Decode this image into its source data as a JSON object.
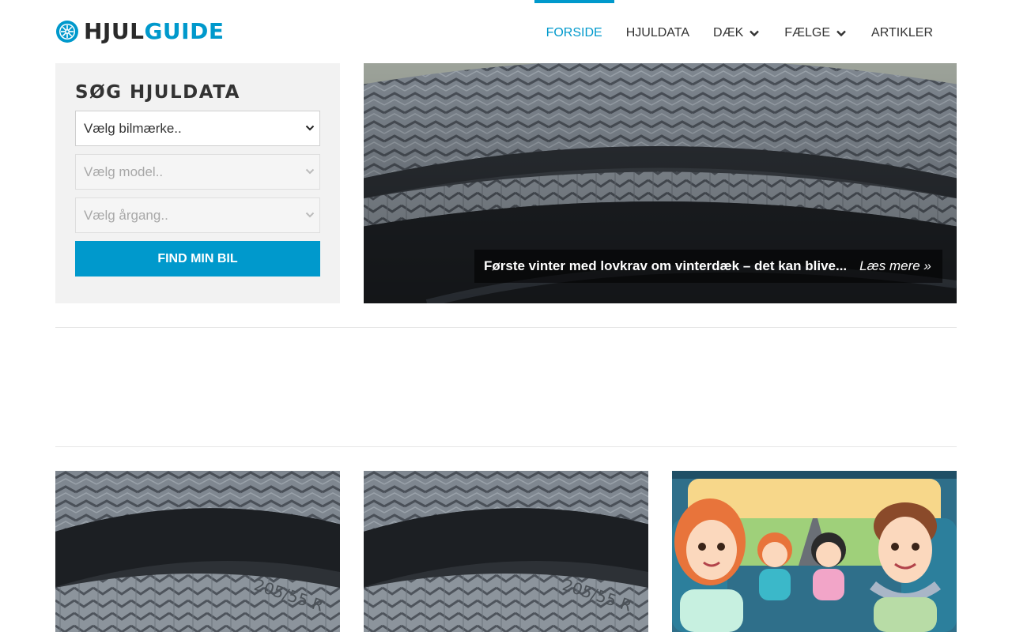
{
  "header": {
    "logo": {
      "part1": "HJUL",
      "part2": "GUIDE",
      "icon": "wheel-logo-icon"
    },
    "nav": [
      {
        "label": "FORSIDE",
        "active": true,
        "dropdown": false
      },
      {
        "label": "HJULDATA",
        "active": false,
        "dropdown": false
      },
      {
        "label": "DÆK",
        "active": false,
        "dropdown": true
      },
      {
        "label": "FÆLGE",
        "active": false,
        "dropdown": true
      },
      {
        "label": "ARTIKLER",
        "active": false,
        "dropdown": false
      }
    ]
  },
  "search": {
    "title": "SØG HJULDATA",
    "brand_select": "Vælg bilmærke..",
    "model_select": "Vælg model..",
    "year_select": "Vælg årgang..",
    "button": "FIND MIN BIL"
  },
  "hero": {
    "title": "Første vinter med lovkrav om vinterdæk – det kan blive...",
    "read_more": "Læs mere »"
  },
  "cards": [
    {
      "image": "tire-closeup-image"
    },
    {
      "image": "tire-closeup-image"
    },
    {
      "image": "cartoon-family-car-image"
    }
  ],
  "colors": {
    "accent": "#0099cc",
    "text": "#333333",
    "panel": "#f2f2f2"
  }
}
